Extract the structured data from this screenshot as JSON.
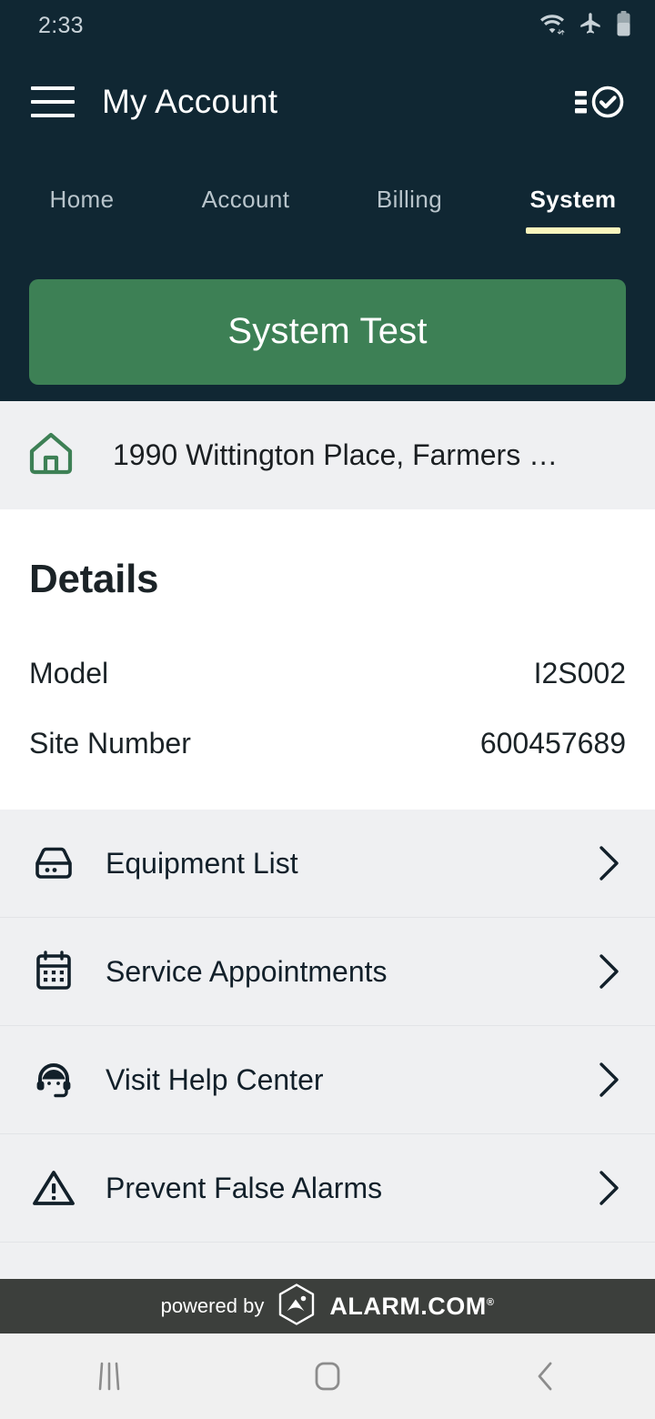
{
  "status_bar": {
    "time": "2:33",
    "icons": [
      "wifi-icon",
      "airplane-mode-icon",
      "battery-icon"
    ]
  },
  "header": {
    "menu_icon": "hamburger-menu-icon",
    "title": "My Account",
    "action_icon": "system-status-checklist-icon"
  },
  "tabs": [
    {
      "label": "Home",
      "active": false
    },
    {
      "label": "Account",
      "active": false
    },
    {
      "label": "Billing",
      "active": false
    },
    {
      "label": "System",
      "active": true
    }
  ],
  "system_test": {
    "label": "System Test"
  },
  "address": {
    "icon": "home-icon",
    "text": "1990 Wittington Place, Farmers …"
  },
  "details": {
    "title": "Details",
    "rows": [
      {
        "key": "Model",
        "value": "I2S002"
      },
      {
        "key": "Site Number",
        "value": "600457689"
      }
    ]
  },
  "list": [
    {
      "icon": "security-panel-icon",
      "label": "Equipment List"
    },
    {
      "icon": "calendar-icon",
      "label": "Service Appointments"
    },
    {
      "icon": "headset-support-icon",
      "label": "Visit Help Center"
    },
    {
      "icon": "warning-triangle-icon",
      "label": "Prevent False Alarms"
    }
  ],
  "footer": {
    "powered_by": "powered by",
    "brand": "ALARM.COM",
    "registered_mark": "®",
    "logo_icon": "alarm-dot-com-hexagon-logo"
  },
  "nav_bar": {
    "recents": "recents-icon",
    "home": "home-button-icon",
    "back": "back-icon"
  },
  "colors": {
    "header_bg": "#102733",
    "accent_green": "#3d8055",
    "tab_underline": "#faf5bd",
    "section_bg": "#eff0f2",
    "footer_bg": "#3c3f3c",
    "text_dark": "#12202a"
  }
}
